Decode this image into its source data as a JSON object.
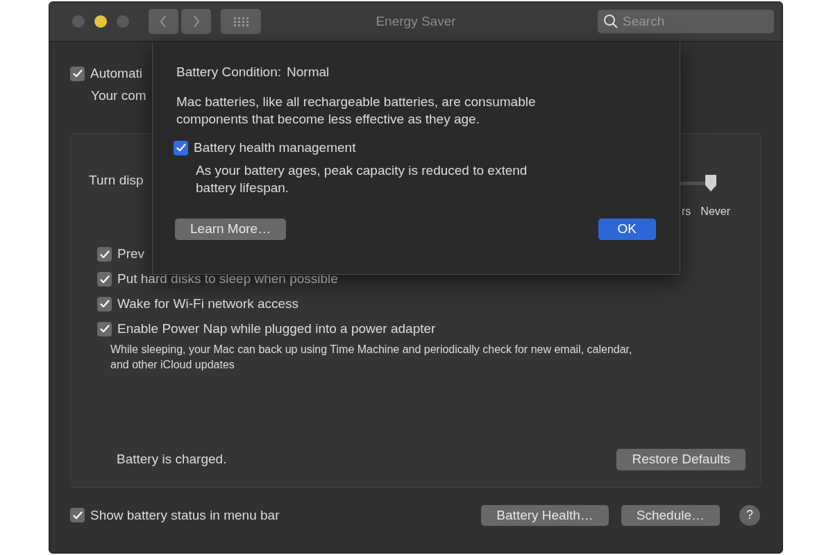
{
  "window": {
    "title": "Energy Saver",
    "lights": [
      {
        "color": "#59595b"
      },
      {
        "color": "#e7c23d"
      },
      {
        "color": "#59595b"
      }
    ],
    "search": {
      "placeholder": "Search"
    }
  },
  "background": {
    "auto_option": {
      "label": "Automati",
      "checked": true
    },
    "auto_note": "Your com",
    "display_label": "Turn disp",
    "slider": {
      "level": 1,
      "tick_labels": [
        "rs",
        "Never"
      ]
    },
    "options": [
      {
        "label": "Prev",
        "checked": true
      },
      {
        "label": "Put hard disks to sleep when possible",
        "checked": true
      },
      {
        "label": "Wake for Wi-Fi network access",
        "checked": true
      },
      {
        "label": "Enable Power Nap while plugged into a power adapter",
        "checked": true,
        "note": "While sleeping, your Mac can back up using Time Machine and periodically check for new email, calendar, and other iCloud updates"
      }
    ],
    "status": "Battery is charged.",
    "restore_button": "Restore Defaults"
  },
  "footer": {
    "menu_bar_option": {
      "label": "Show battery status in menu bar",
      "checked": true
    },
    "buttons": [
      "Battery Health…",
      "Schedule…"
    ],
    "help": "?"
  },
  "sheet": {
    "condition_label": "Battery Condition:",
    "condition_value": "Normal",
    "description": "Mac batteries, like all rechargeable batteries, are consumable components that become less effective as they age.",
    "health_option": {
      "label": "Battery health management",
      "checked": true,
      "note": "As your battery ages, peak capacity is reduced to extend battery lifespan."
    },
    "buttons": [
      {
        "label": "Learn More…",
        "kind": "default"
      },
      {
        "label": "OK",
        "kind": "primary"
      }
    ]
  }
}
